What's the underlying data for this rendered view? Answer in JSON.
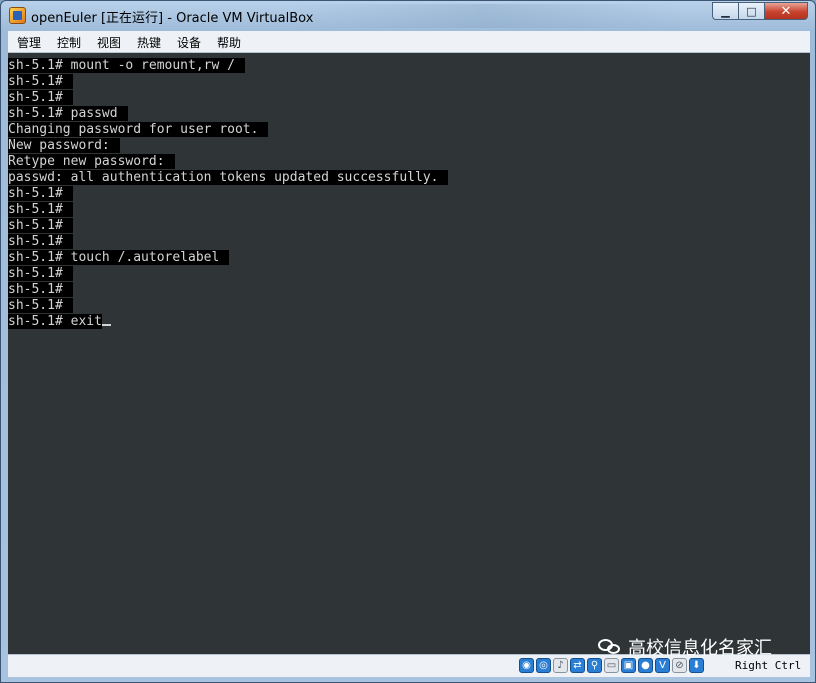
{
  "window": {
    "title": "openEuler [正在运行] - Oracle VM VirtualBox",
    "app_icon": "virtualbox-icon",
    "controls": {
      "minimize": "minimize-icon",
      "maximize": "maximize-icon",
      "close": "close-icon"
    }
  },
  "menubar": {
    "items": [
      {
        "label": "管理"
      },
      {
        "label": "控制"
      },
      {
        "label": "视图"
      },
      {
        "label": "热键"
      },
      {
        "label": "设备"
      },
      {
        "label": "帮助"
      }
    ]
  },
  "terminal": {
    "lines": [
      "sh-5.1# mount -o remount,rw /",
      "sh-5.1#",
      "sh-5.1#",
      "sh-5.1# passwd",
      "Changing password for user root.",
      "New password:",
      "Retype new password:",
      "passwd: all authentication tokens updated successfully.",
      "sh-5.1#",
      "sh-5.1#",
      "sh-5.1#",
      "sh-5.1#",
      "sh-5.1# touch /.autorelabel",
      "sh-5.1#",
      "sh-5.1#",
      "sh-5.1#",
      "sh-5.1# exit"
    ],
    "colors": {
      "background": "#2f3437",
      "line_highlight": "#000000",
      "text": "#d4d4d4"
    }
  },
  "statusbar": {
    "icons": [
      "hard-disk-icon",
      "optical-drive-icon",
      "audio-icon",
      "network-icon",
      "usb-icon",
      "shared-folders-icon",
      "display-icon",
      "video-capture-icon",
      "virtualization-icon",
      "mouse-integration-icon",
      "keyboard-capture-icon"
    ],
    "host_key": "Right Ctrl"
  },
  "watermark": {
    "text": "高校信息化名家汇",
    "icon": "wechat-icon"
  }
}
